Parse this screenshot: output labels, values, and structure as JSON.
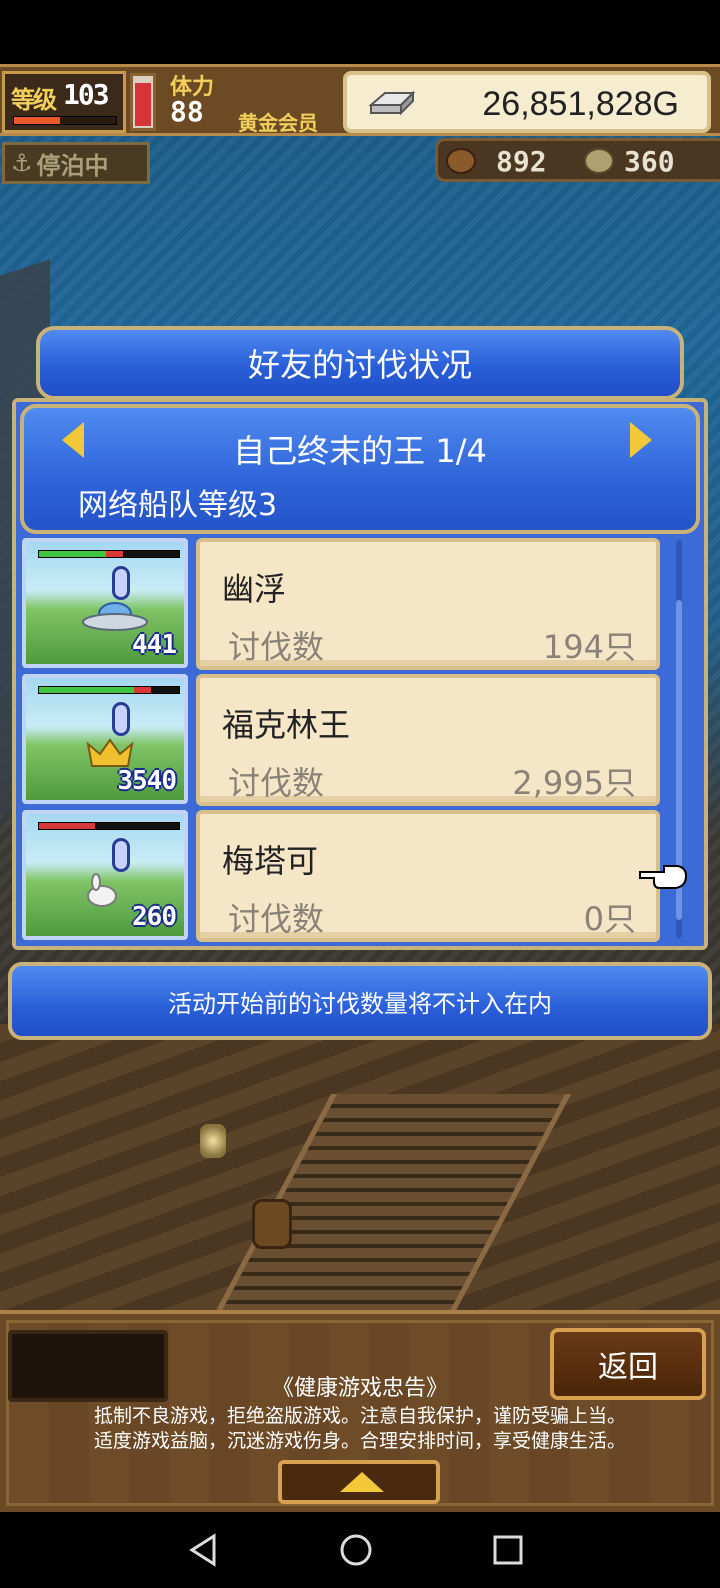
{
  "hud": {
    "level_label": "等级",
    "level": "103",
    "level_progress": 0.45,
    "stamina_label": "体力",
    "stamina": "88",
    "stamina_level": 0.9,
    "membership": "黄金会员",
    "gold": "26,851,828G",
    "dock_status": "停泊中",
    "resource_1": "892",
    "resource_2": "360"
  },
  "dialog": {
    "title": "好友的讨伐状况",
    "boss": "自己终末的王 1/4",
    "fleet_level": "网络船队等级3",
    "notice": "活动开始前的讨伐数量将不计入在内"
  },
  "friends": [
    {
      "name": "幽浮",
      "kill_label": "讨伐数",
      "kills": "194只",
      "power": "441",
      "hp_green": 0.48,
      "monster": "ufo-icon"
    },
    {
      "name": "福克林王",
      "kill_label": "讨伐数",
      "kills": "2,995只",
      "power": "3540",
      "hp_green": 0.68,
      "monster": "crown-monster-icon"
    },
    {
      "name": "梅塔可",
      "kill_label": "讨伐数",
      "kills": "0只",
      "power": "260",
      "hp_green": 0.0,
      "monster": "rabbit-monster-icon"
    }
  ],
  "bottom": {
    "back_label": "返回",
    "health_title": "《健康游戏忠告》",
    "health_line1": "抵制不良游戏，拒绝盗版游戏。注意自我保护，谨防受骗上当。",
    "health_line2": "适度游戏益脑，沉迷游戏伤身。合理安排时间，享受健康生活。"
  },
  "colors": {
    "dialog_blue": "#2a5fd8",
    "gold_frame": "#c9b17a",
    "card_bg": "#f5e6c8"
  }
}
